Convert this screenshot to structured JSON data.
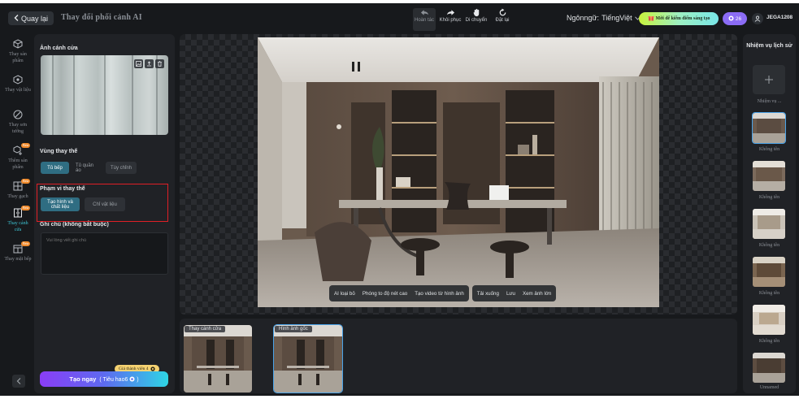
{
  "header": {
    "back_label": "Quay lại",
    "title": "Thay đổi phối cảnh AI",
    "tools": [
      {
        "label": "Hoàn tác",
        "icon": "undo-icon"
      },
      {
        "label": "Khôi phục",
        "icon": "redo-icon"
      },
      {
        "label": "Di chuyển",
        "icon": "hand-icon"
      },
      {
        "label": "Đặt lại",
        "icon": "reset-icon"
      }
    ],
    "language_label": "Ngônngữ:",
    "language_value": "TiếngViệt",
    "promo_label": "Mời để kiếm điểm sáng tạo",
    "credits": "26",
    "username": "JEGA1208"
  },
  "left_nav": {
    "items": [
      {
        "label": "Thay sản phẩm",
        "icon": "cube-icon",
        "beta": ""
      },
      {
        "label": "Thay vật liệu",
        "icon": "material-icon",
        "beta": ""
      },
      {
        "label": "Thay sơn tường",
        "icon": "paint-icon",
        "beta": ""
      },
      {
        "label": "Thêm sản phẩm",
        "icon": "add-product-icon",
        "beta": "Beta"
      },
      {
        "label": "Thay gạch",
        "icon": "tile-icon",
        "beta": "Beta"
      },
      {
        "label": "Thay cánh cửa",
        "icon": "door-icon",
        "beta": "Beta"
      },
      {
        "label": "Thay mặt bếp",
        "icon": "countertop-icon",
        "beta": "Beta"
      }
    ]
  },
  "panel": {
    "door_section_title": "Ảnh cánh cửa",
    "region_title": "Vùng thay thế",
    "region_options": [
      "Tủ bếp",
      "Tủ quần áo",
      "Tùy chỉnh"
    ],
    "scope_title": "Phạm vi thay thế",
    "scope_options": [
      "Tạo hình và chất liệu",
      "Chỉ vật liệu"
    ],
    "notes_title": "Ghi chú (không bắt buộc)",
    "notes_placeholder": "Vui lòng viết ghi chú",
    "member_price": "Giá thành viên 4",
    "create_label": "Tạo ngay",
    "create_cost": "( Tiêu hao6",
    "create_cost_close": ")"
  },
  "canvas": {
    "actions_left": [
      "AI loại bỏ",
      "Phóng to độ nét cao",
      "Tạo video từ hình ảnh"
    ],
    "actions_right": [
      "Tải xuống",
      "Lưu",
      "Xem ảnh lớn"
    ]
  },
  "results": [
    {
      "label": "Thay cánh cửa"
    },
    {
      "label": "Hình ảnh gốc"
    }
  ],
  "history": {
    "title": "Nhiệm vụ lịch sử",
    "new_task_label": "Nhiệm vụ ...",
    "items": [
      "Không tên",
      "Không tên",
      "Không tên",
      "Không tên",
      "Không tên",
      "Unnamed"
    ]
  },
  "colors": {
    "accent": "#3ec5d4",
    "selected_chip": "#2f6d82",
    "highlight": "#e01f26"
  }
}
